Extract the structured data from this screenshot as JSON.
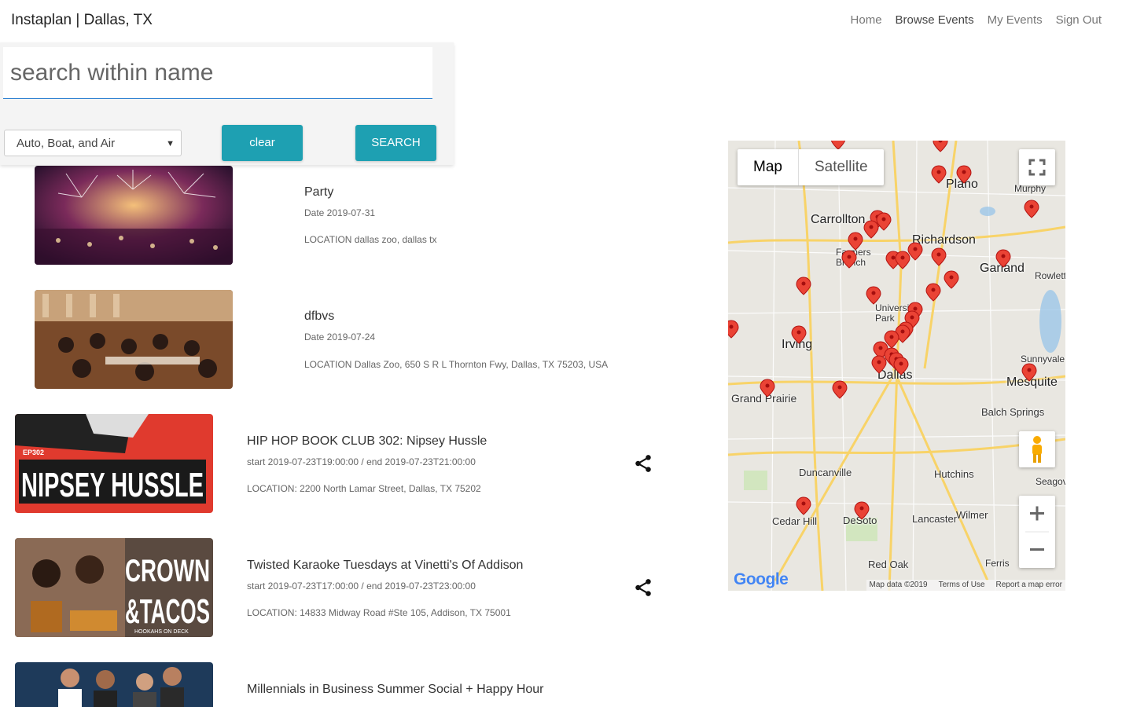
{
  "header": {
    "brand": "Instaplan | Dallas, TX",
    "nav": [
      "Home",
      "Browse Events",
      "My Events",
      "Sign Out"
    ]
  },
  "search": {
    "placeholder": "search within name",
    "category": "Auto, Boat, and Air",
    "clear_label": "clear",
    "search_label": "SEARCH"
  },
  "events": [
    {
      "title": "Party",
      "date": "Date 2019-07-31",
      "location": "LOCATION dallas zoo, dallas tx"
    },
    {
      "title": "dfbvs",
      "date": "Date 2019-07-24",
      "location": "LOCATION Dallas Zoo, 650 S R L Thornton Fwy, Dallas, TX 75203, USA"
    },
    {
      "title": "HIP HOP BOOK CLUB 302: Nipsey Hussle",
      "date": "start 2019-07-23T19:00:00 / end 2019-07-23T21:00:00",
      "location": "LOCATION: 2200 North Lamar Street, Dallas, TX 75202",
      "image_text": "NIPSEY HUSSLE",
      "image_badge": "EP302"
    },
    {
      "title": "Twisted Karaoke Tuesdays at Vinetti's Of Addison",
      "date": "start 2019-07-23T17:00:00 / end 2019-07-23T23:00:00",
      "location": "LOCATION: 14833 Midway Road #Ste 105, Addison, TX 75001",
      "image_text_1": "CROWN",
      "image_text_2": "&TACOS",
      "image_sub": "HOOKAHS ON DECK"
    },
    {
      "title": "Millennials in Business Summer Social + Happy Hour",
      "date": "",
      "location": ""
    }
  ],
  "map": {
    "type_map": "Map",
    "type_satellite": "Satellite",
    "cities": [
      "Plano",
      "Murphy",
      "Carrollton",
      "Richardson",
      "Farmers Branch",
      "Garland",
      "Rowlett",
      "University Park",
      "Irving",
      "Dallas",
      "Sunnyvale",
      "Mesquite",
      "Grand Prairie",
      "Balch Springs",
      "Duncanville",
      "Hutchins",
      "Seagoville",
      "Cedar Hill",
      "DeSoto",
      "Lancaster",
      "Wilmer",
      "Red Oak",
      "Ferris"
    ],
    "footer": [
      "Map data ©2019",
      "Terms of Use",
      "Report a map error"
    ],
    "logo": "Google"
  }
}
